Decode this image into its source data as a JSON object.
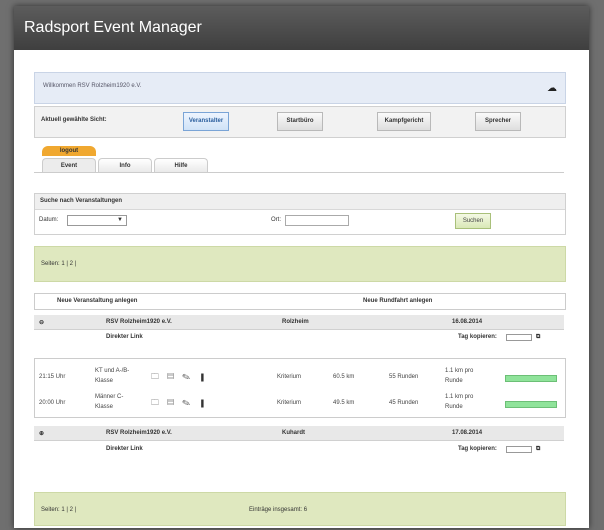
{
  "app_title": "Radsport Event Manager",
  "welcome_text": "Willkommen RSV Rolzheim1920 e.V.",
  "view_label": "Aktuell gewählte Sicht:",
  "view_buttons": [
    "Veranstalter",
    "Startbüro",
    "Kampfgericht",
    "Sprecher"
  ],
  "logout_label": "logout",
  "tabs": [
    "Event",
    "Info",
    "Hilfe"
  ],
  "search": {
    "title": "Suche nach Veranstaltungen",
    "date_label": "Datum:",
    "location_label": "Ort:",
    "button": "Suchen"
  },
  "pagination_top": "Seiten: 1 | 2 |",
  "actions": {
    "new_event": "Neue Veranstaltung anlegen",
    "new_round": "Neue Rundfahrt anlegen"
  },
  "events": [
    {
      "club": "RSV Rolzheim1920 e.V.",
      "place": "Rolzheim",
      "date": "16.08.2014",
      "direct_link": "Direkter Link",
      "copy_label": "Tag kopieren:"
    },
    {
      "club": "RSV Rolzheim1920 e.V.",
      "place": "Kuhardt",
      "date": "17.08.2014",
      "direct_link": "Direkter Link",
      "copy_label": "Tag kopieren:"
    }
  ],
  "races": [
    {
      "time": "21:15 Uhr",
      "class_line1": "KT und A-/B-",
      "class_line2": "Klasse",
      "type": "Kriterium",
      "distance": "60.5 km",
      "rounds": "55 Runden",
      "per_round1": "1.1 km pro",
      "per_round2": "Runde",
      "progress": 1.0
    },
    {
      "time": "20:00 Uhr",
      "class_line1": "Männer C-",
      "class_line2": "Klasse",
      "type": "Kriterium",
      "distance": "49.5 km",
      "rounds": "45 Runden",
      "per_round1": "1.1 km pro",
      "per_round2": "Runde",
      "progress": 1.0
    }
  ],
  "pagination_bottom": "Seiten: 1 | 2 |",
  "total_entries": "Einträge insgesamt: 6"
}
